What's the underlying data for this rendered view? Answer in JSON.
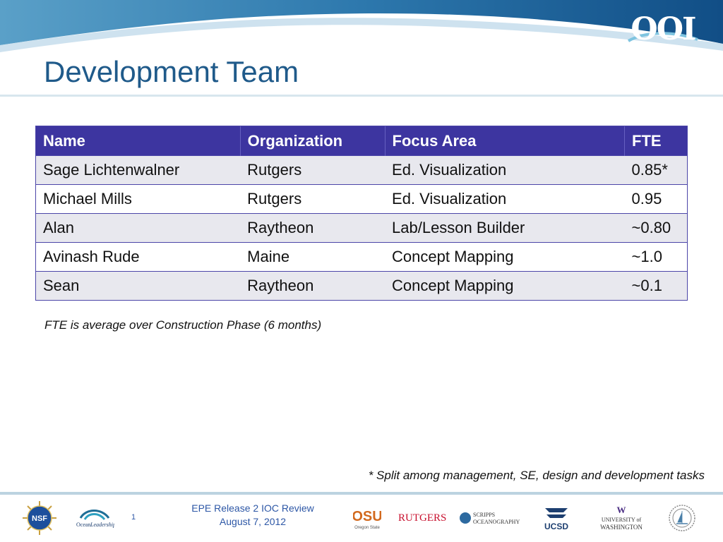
{
  "header": {
    "logo_text": "OOI",
    "title": "Development Team"
  },
  "table": {
    "columns": [
      "Name",
      "Organization",
      "Focus Area",
      "FTE"
    ],
    "rows": [
      [
        "Sage Lichtenwalner",
        "Rutgers",
        "Ed. Visualization",
        "0.85*"
      ],
      [
        "Michael Mills",
        "Rutgers",
        "Ed. Visualization",
        "0.95"
      ],
      [
        "Alan",
        "Raytheon",
        "Lab/Lesson Builder",
        "~0.80"
      ],
      [
        "Avinash Rude",
        "Maine",
        "Concept Mapping",
        "~1.0"
      ],
      [
        "Sean",
        "Raytheon",
        "Concept Mapping",
        "~0.1"
      ]
    ]
  },
  "notes": {
    "fte": "FTE is average over Construction Phase (6 months)",
    "split": "* Split among management, SE, design and development tasks"
  },
  "footer": {
    "page_number": "1",
    "line1": "EPE Release 2 IOC Review",
    "line2": "August 7, 2012",
    "logos": {
      "nsf": "NSF",
      "ocean_leadership_1": "Ocean",
      "ocean_leadership_2": "Leadership",
      "osu_1": "OSU",
      "osu_2": "Oregon State",
      "rutgers": "RUTGERS",
      "scripps_1": "SCRIPPS",
      "scripps_2": "OCEANOGRAPHY",
      "ucsd": "UCSD",
      "uw_1": "W",
      "uw_2": "UNIVERSITY of",
      "uw_3": "WASHINGTON"
    }
  },
  "colors": {
    "title": "#1f5a8a",
    "table_header": "#3d35a0",
    "row_shade": "#e8e8ee",
    "footer_text": "#2d57a6"
  }
}
